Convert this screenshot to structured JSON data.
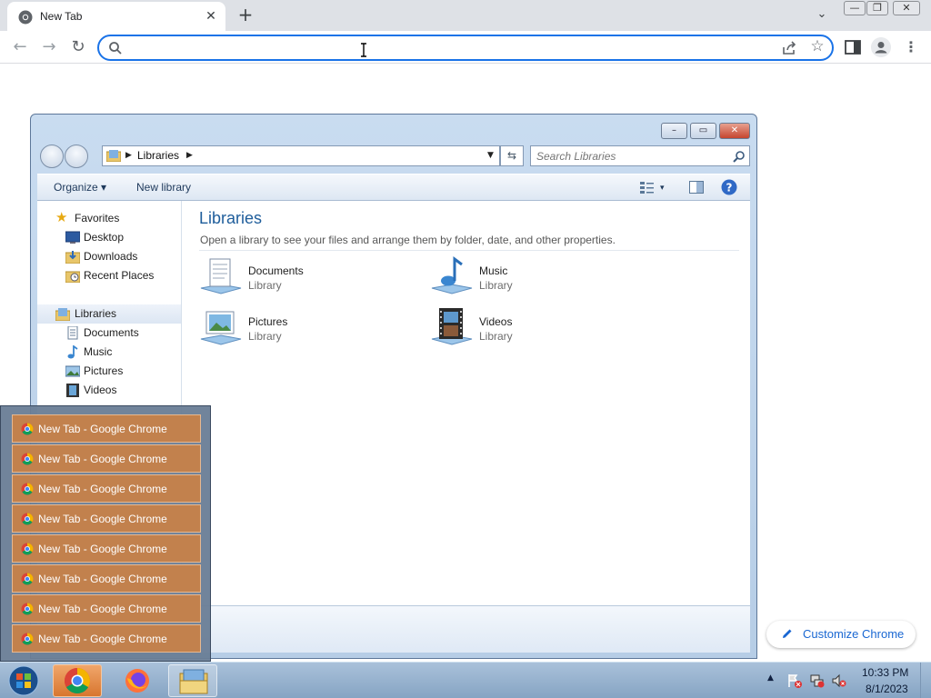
{
  "browser": {
    "tab": {
      "title": "New Tab",
      "close": "✕"
    },
    "new_tab": "+",
    "tab_search": "⌄",
    "caption": {
      "minimize": "—",
      "restore": "❐",
      "close": "✕"
    },
    "nav": {
      "back": "←",
      "forward": "→",
      "reload": "↻"
    },
    "omnibox": {
      "value": "",
      "placeholder": ""
    },
    "menu": "⋮",
    "accent_color": "#1a73e8"
  },
  "explorer": {
    "window_buttons": {
      "minimize": "–",
      "maximize": "▭",
      "close": "✕"
    },
    "breadcrumb": {
      "location": "Libraries"
    },
    "search": {
      "placeholder": "Search Libraries"
    },
    "commands": {
      "organize": "Organize ▾",
      "new_library": "New library",
      "view": "▾"
    },
    "nav_pane": {
      "favorites": "Favorites",
      "favorites_items": [
        "Desktop",
        "Downloads",
        "Recent Places"
      ],
      "libraries": "Libraries",
      "libraries_items": [
        "Documents",
        "Music",
        "Pictures",
        "Videos"
      ]
    },
    "main": {
      "title": "Libraries",
      "subtitle": "Open a library to see your files and arrange them by folder, date, and other properties.",
      "items": [
        {
          "name": "Documents",
          "type": "Library",
          "icon": "documents-library-icon"
        },
        {
          "name": "Music",
          "type": "Library",
          "icon": "music-library-icon"
        },
        {
          "name": "Pictures",
          "type": "Library",
          "icon": "pictures-library-icon"
        },
        {
          "name": "Videos",
          "type": "Library",
          "icon": "videos-library-icon"
        }
      ]
    }
  },
  "taskbar_popup": {
    "items": [
      "New Tab - Google Chrome",
      "New Tab - Google Chrome",
      "New Tab - Google Chrome",
      "New Tab - Google Chrome",
      "New Tab - Google Chrome",
      "New Tab - Google Chrome",
      "New Tab - Google Chrome",
      "New Tab - Google Chrome"
    ]
  },
  "customize_chrome": {
    "label": "Customize Chrome"
  },
  "taskbar": {
    "tray_arrow": "▲",
    "time": "10:33 PM",
    "date": "8/1/2023"
  }
}
